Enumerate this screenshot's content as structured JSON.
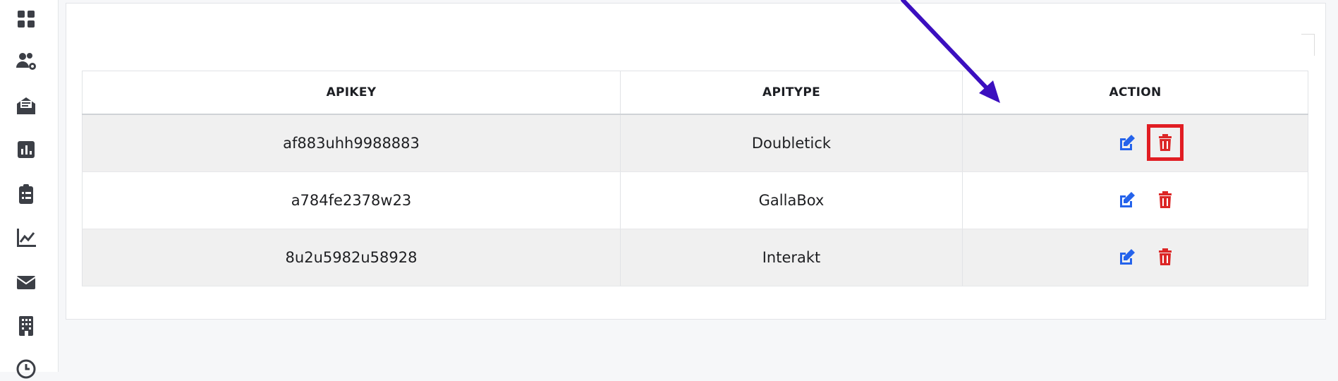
{
  "sidebar": {
    "items": [
      {
        "icon": "grid-icon"
      },
      {
        "icon": "users-settings-icon"
      },
      {
        "icon": "envelope-open-icon"
      },
      {
        "icon": "bar-chart-icon"
      },
      {
        "icon": "clipboard-list-icon"
      },
      {
        "icon": "line-chart-icon"
      },
      {
        "icon": "envelope-icon"
      },
      {
        "icon": "building-icon"
      },
      {
        "icon": "clock-icon"
      }
    ]
  },
  "table": {
    "headers": [
      "APIKEY",
      "APITYPE",
      "ACTION"
    ],
    "rows": [
      {
        "apikey": "af883uhh9988883",
        "apitype": "Doubletick"
      },
      {
        "apikey": "a784fe2378w23",
        "apitype": "GallaBox"
      },
      {
        "apikey": "8u2u5982u58928",
        "apitype": "Interakt"
      }
    ]
  },
  "colors": {
    "edit": "#2563eb",
    "delete": "#dc2626",
    "annotation_arrow": "#3b0fbf",
    "annotation_box": "#e11d23"
  }
}
